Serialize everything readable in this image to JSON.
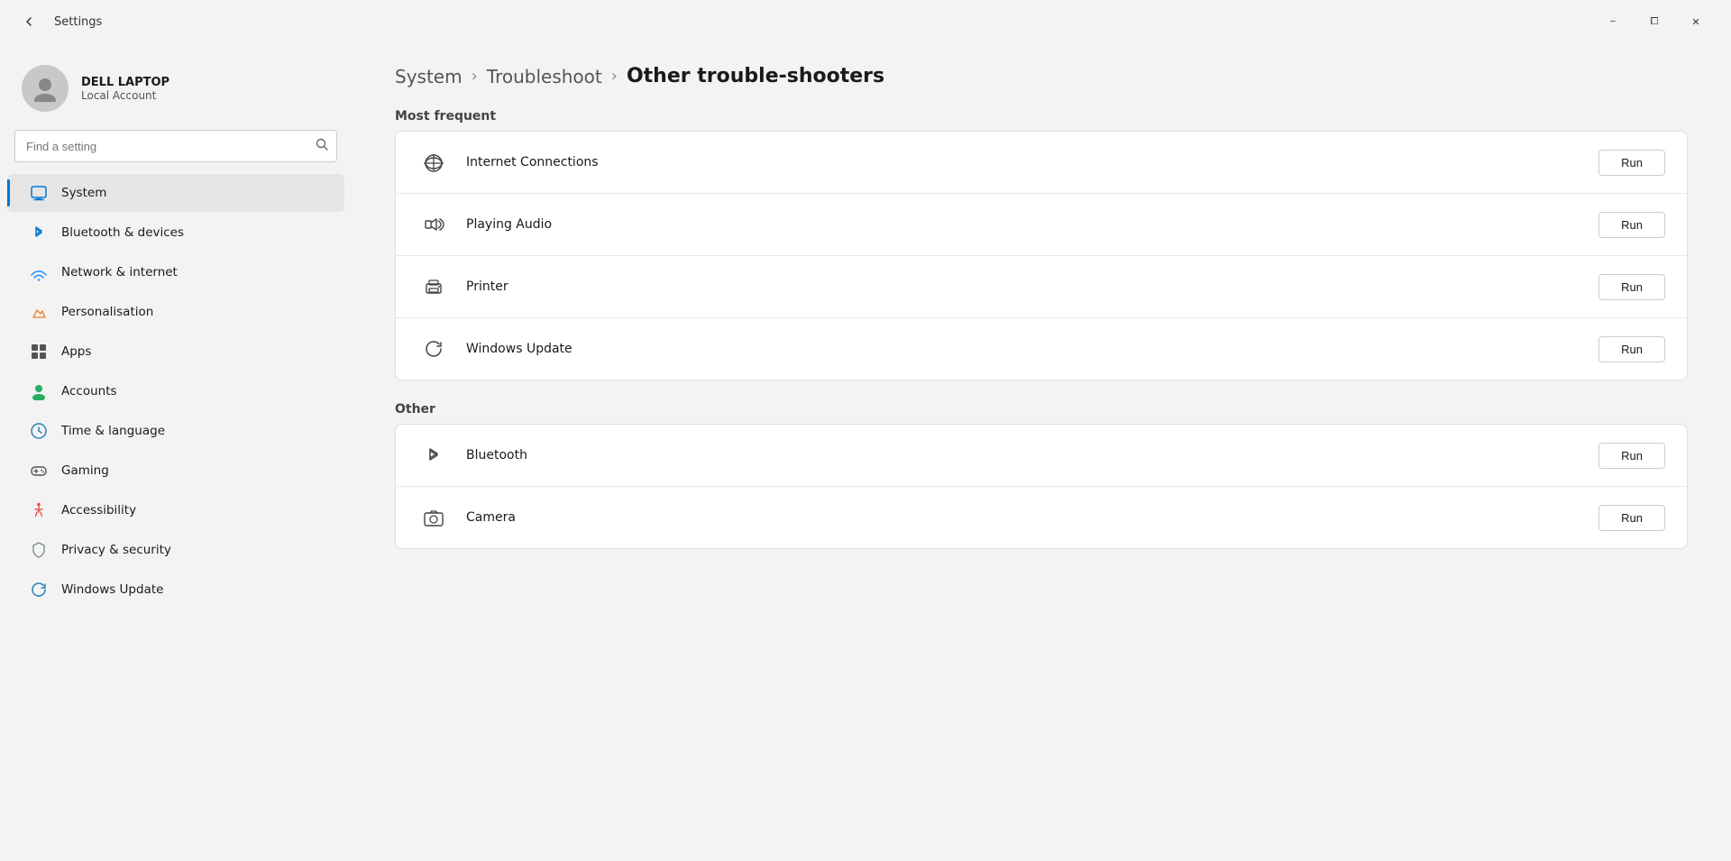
{
  "window": {
    "title": "Settings",
    "min_label": "−",
    "max_label": "⧠",
    "close_label": "✕"
  },
  "user": {
    "name": "DELL LAPTOP",
    "type": "Local Account"
  },
  "search": {
    "placeholder": "Find a setting"
  },
  "nav": {
    "back_label": "←",
    "items": [
      {
        "id": "system",
        "label": "System",
        "active": true
      },
      {
        "id": "bluetooth",
        "label": "Bluetooth & devices",
        "active": false
      },
      {
        "id": "network",
        "label": "Network & internet",
        "active": false
      },
      {
        "id": "personalisation",
        "label": "Personalisation",
        "active": false
      },
      {
        "id": "apps",
        "label": "Apps",
        "active": false
      },
      {
        "id": "accounts",
        "label": "Accounts",
        "active": false
      },
      {
        "id": "time",
        "label": "Time & language",
        "active": false
      },
      {
        "id": "gaming",
        "label": "Gaming",
        "active": false
      },
      {
        "id": "accessibility",
        "label": "Accessibility",
        "active": false
      },
      {
        "id": "privacy",
        "label": "Privacy & security",
        "active": false
      },
      {
        "id": "update",
        "label": "Windows Update",
        "active": false
      }
    ]
  },
  "breadcrumb": {
    "items": [
      {
        "label": "System"
      },
      {
        "label": "Troubleshoot"
      }
    ],
    "current": "Other trouble-shooters"
  },
  "most_frequent": {
    "section_title": "Most frequent",
    "items": [
      {
        "name": "Internet Connections",
        "run": "Run"
      },
      {
        "name": "Playing Audio",
        "run": "Run"
      },
      {
        "name": "Printer",
        "run": "Run"
      },
      {
        "name": "Windows Update",
        "run": "Run"
      }
    ]
  },
  "other": {
    "section_title": "Other",
    "items": [
      {
        "name": "Bluetooth",
        "run": "Run"
      },
      {
        "name": "Camera",
        "run": "Run"
      }
    ]
  }
}
